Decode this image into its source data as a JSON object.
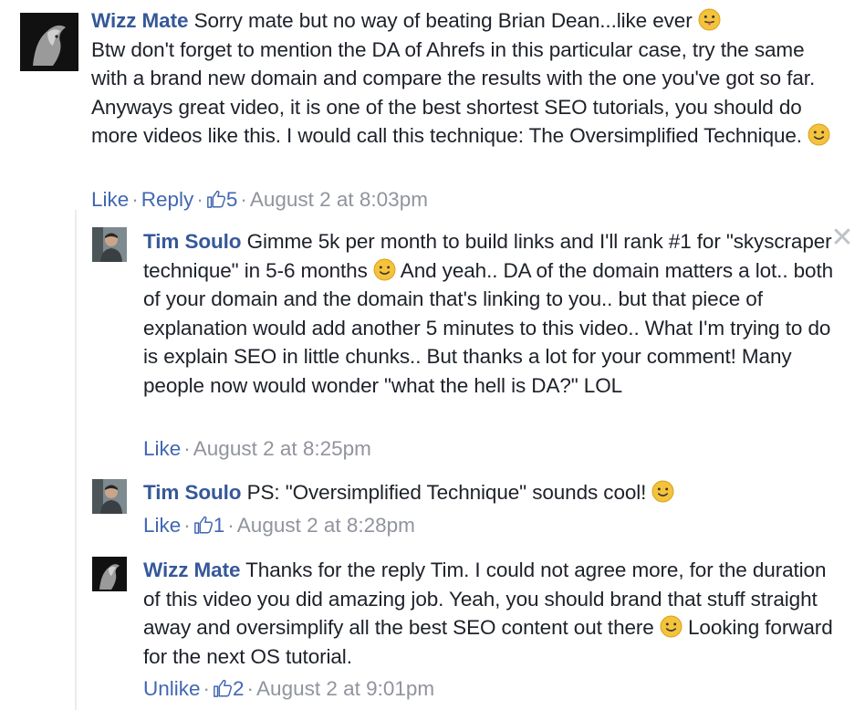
{
  "comments": [
    {
      "author": "Wizz Mate",
      "text_parts": [
        "Sorry mate but no way of beating Brian Dean...like ever ",
        "\nBtw don't forget to mention the DA of Ahrefs in this particular case, try the same with a brand new domain and compare the results with the one you've got so far. Anyways great video, it is one of the best shortest SEO tutorials, you should do more videos like this. I would call this technique: The Oversimplified Technique. "
      ],
      "action_like": "Like",
      "action_reply": "Reply",
      "likes": "5",
      "timestamp": "August 2 at 8:03pm"
    },
    {
      "author": "Tim Soulo",
      "text_parts": [
        "Gimme 5k per month to build links and I'll rank #1 for \"skyscraper technique\" in 5-6 months ",
        " And yeah.. DA of the domain matters a lot.. both of your domain and the domain that's linking to you.. but that piece of explanation would add another 5 minutes to this video.. What I'm trying to do is explain SEO in little chunks.. But thanks a lot for your comment! Many people now would wonder \"what the hell is DA?\" LOL"
      ],
      "action_like": "Like",
      "timestamp": "August 2 at 8:25pm"
    },
    {
      "author": "Tim Soulo",
      "text_parts": [
        "PS: \"Oversimplified Technique\" sounds cool! "
      ],
      "action_like": "Like",
      "likes": "1",
      "timestamp": "August 2 at 8:28pm"
    },
    {
      "author": "Wizz Mate",
      "text_parts": [
        "Thanks for the reply Tim. I could not agree more, for the duration of this video you did amazing job. Yeah, you should brand that stuff straight away and oversimplify all the best SEO content out there ",
        " Looking forward for the next OS tutorial."
      ],
      "action_like": "Unlike",
      "likes": "2",
      "timestamp": "August 2 at 9:01pm"
    }
  ],
  "separator": "·",
  "close_glyph": "✕",
  "colors": {
    "name": "#365899",
    "link": "#4267b2",
    "meta": "#90949c",
    "text": "#1d2129",
    "emoji": "#f5c33b"
  },
  "icons": [
    "tongue-out-emoji-icon",
    "smile-emoji-icon",
    "thumbs-up-icon",
    "close-icon"
  ]
}
